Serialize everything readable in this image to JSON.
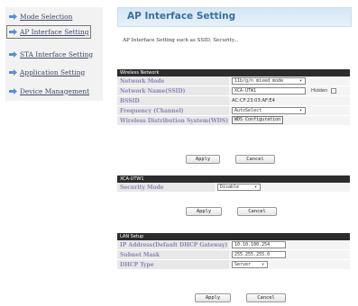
{
  "sidebar": {
    "items": [
      {
        "label": "Mode Selection"
      },
      {
        "label": "AP Interface Setting"
      },
      {
        "label": "STA Interface Setting"
      },
      {
        "label": "Application Setting"
      },
      {
        "label": "Device Management"
      }
    ]
  },
  "header": {
    "title": "AP Interface Setting",
    "description": "AP Interface Setting such as SSID, Security..."
  },
  "wireless": {
    "title": "Wireless Network",
    "rows": [
      {
        "label": "Network Mode",
        "value": "11b/g/n mixed mode"
      },
      {
        "label": "Network Name(SSID)",
        "value": "XCA-UTW1",
        "hidden_label": "Hidden"
      },
      {
        "label": "BSSID",
        "value": "AC:CF:23:03:AF:E4"
      },
      {
        "label": "Frequency (Channel)",
        "value": "AutoSelect"
      },
      {
        "label": "Wireless Distribution System(WDS)",
        "value": "WDS Configuration"
      }
    ],
    "apply": "Apply",
    "cancel": "Cancel"
  },
  "security": {
    "title": "XCA-UTW1",
    "rows": [
      {
        "label": "Security Mode",
        "value": "Disable"
      }
    ],
    "apply": "Apply",
    "cancel": "Cancel"
  },
  "lan": {
    "title": "LAN Setup",
    "rows": [
      {
        "label": "IP Address(Default DHCP Gateway)",
        "value": "10.10.100.254"
      },
      {
        "label": "Subnet Mask",
        "value": "255.255.255.0"
      },
      {
        "label": "DHCP Type",
        "value": "Server"
      }
    ],
    "apply": "Apply",
    "cancel": "Cancel"
  },
  "colors": {
    "accent": "#3b6fa0",
    "section_header": "#2c2c2c",
    "label_text": "#8b87b8"
  },
  "icons": [
    "arrow-bullet-icon",
    "dropdown-arrow-icon",
    "checkbox-icon"
  ]
}
